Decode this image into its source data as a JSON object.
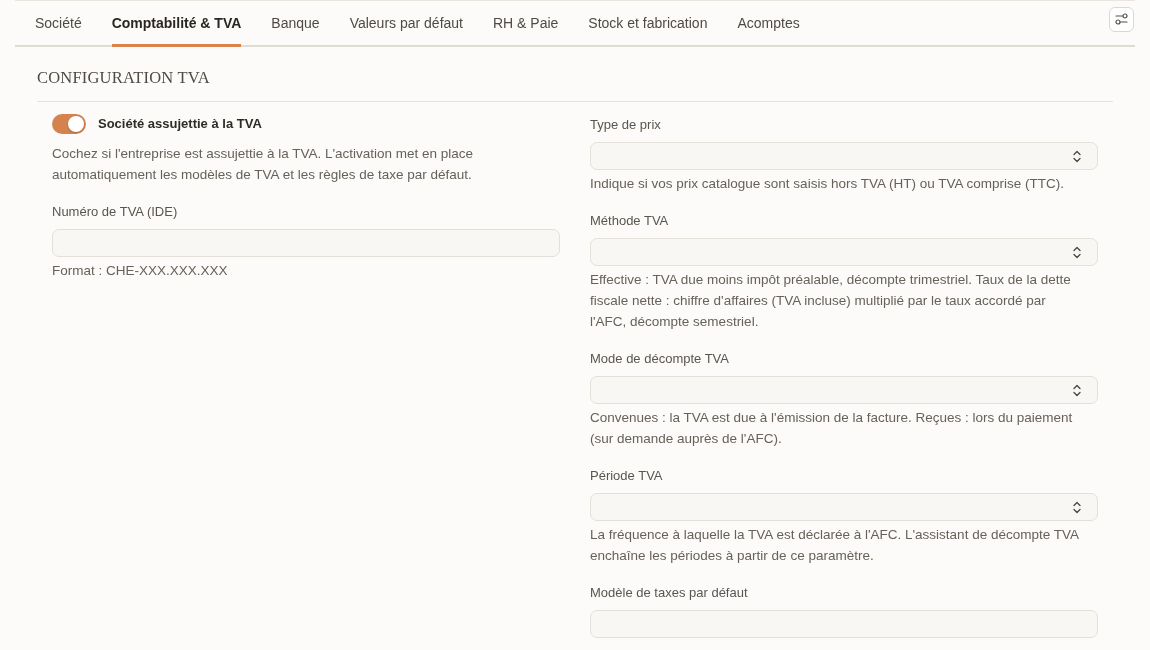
{
  "tabs": [
    {
      "label": "Société",
      "selected": false
    },
    {
      "label": "Comptabilité & TVA",
      "selected": true
    },
    {
      "label": "Banque",
      "selected": false
    },
    {
      "label": "Valeurs par défaut",
      "selected": false
    },
    {
      "label": "RH & Paie",
      "selected": false
    },
    {
      "label": "Stock et fabrication",
      "selected": false
    },
    {
      "label": "Acomptes",
      "selected": false
    }
  ],
  "section": {
    "title": "CONFIGURATION TVA"
  },
  "left_column": [
    {
      "kind": "toggle",
      "label": "Société assujettie à la TVA",
      "on": true,
      "help": "Cochez si l'entreprise est assujettie à la TVA. L'activation met en place automatiquement les modèles de TVA et les règles de taxe par défaut."
    },
    {
      "kind": "text",
      "label": "Numéro de TVA (IDE)",
      "help": "Format : CHE-XXX.XXX.XXX"
    }
  ],
  "right_column": [
    {
      "kind": "select",
      "label": "Type de prix",
      "help": "Indique si vos prix catalogue sont saisis hors TVA (HT) ou TVA comprise (TTC)."
    },
    {
      "kind": "select",
      "label": "Méthode TVA",
      "help": "Effective : TVA due moins impôt préalable, décompte trimestriel. Taux de la dette fiscale nette : chiffre d'affaires (TVA incluse) multiplié par le taux accordé par l'AFC, décompte semestriel."
    },
    {
      "kind": "select",
      "label": "Mode de décompte TVA",
      "help": "Convenues : la TVA est due à l'émission de la facture. Reçues : lors du paiement (sur demande auprès de l'AFC)."
    },
    {
      "kind": "select",
      "label": "Période TVA",
      "help": "La fréquence à laquelle la TVA est déclarée à l'AFC. L'assistant de décompte TVA enchaîne les périodes à partir de ce paramètre."
    },
    {
      "kind": "text",
      "label": "Modèle de taxes par défaut"
    }
  ]
}
